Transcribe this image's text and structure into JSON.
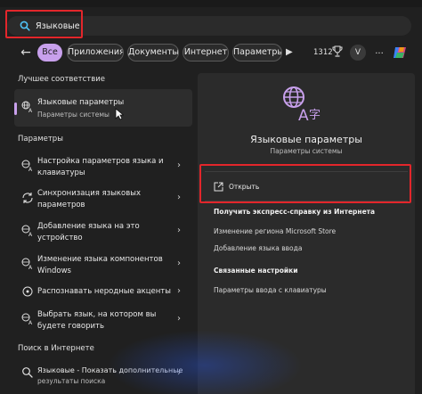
{
  "search": {
    "value": "Языковые"
  },
  "filters": [
    "Все",
    "Приложения",
    "Документы",
    "Интернет",
    "Параметры"
  ],
  "toolbar": {
    "count": "1312",
    "avatar_letter": "V",
    "more": "..."
  },
  "best_match": {
    "header": "Лучшее соответствие",
    "title": "Языковые параметры",
    "subtitle": "Параметры системы"
  },
  "settings": {
    "header": "Параметры",
    "items": [
      {
        "line1": "Настройка параметров языка и",
        "line2": "клавиатуры"
      },
      {
        "line1": "Синхронизация языковых",
        "line2": "параметров"
      },
      {
        "line1": "Добавление языка на это",
        "line2": "устройство"
      },
      {
        "line1": "Изменение языка компонентов",
        "line2": "Windows"
      },
      {
        "line1": "Распознавать неродные акценты",
        "line2": ""
      },
      {
        "line1": "Выбрать язык, на котором вы",
        "line2": "будете говорить"
      }
    ]
  },
  "web": {
    "header": "Поиск в Интернете",
    "line1": "Языковые - Показать дополнительные",
    "line2": "результаты поиска"
  },
  "detail": {
    "title": "Языковые параметры",
    "subtitle": "Параметры системы",
    "open": "Открыть",
    "help_header": "Получить экспресс-справку из Интернета",
    "help_links": [
      "Изменение региона Microsoft Store",
      "Добавление языка ввода"
    ],
    "related_header": "Связанные настройки",
    "related_links": [
      "Параметры ввода с клавиатуры"
    ]
  }
}
